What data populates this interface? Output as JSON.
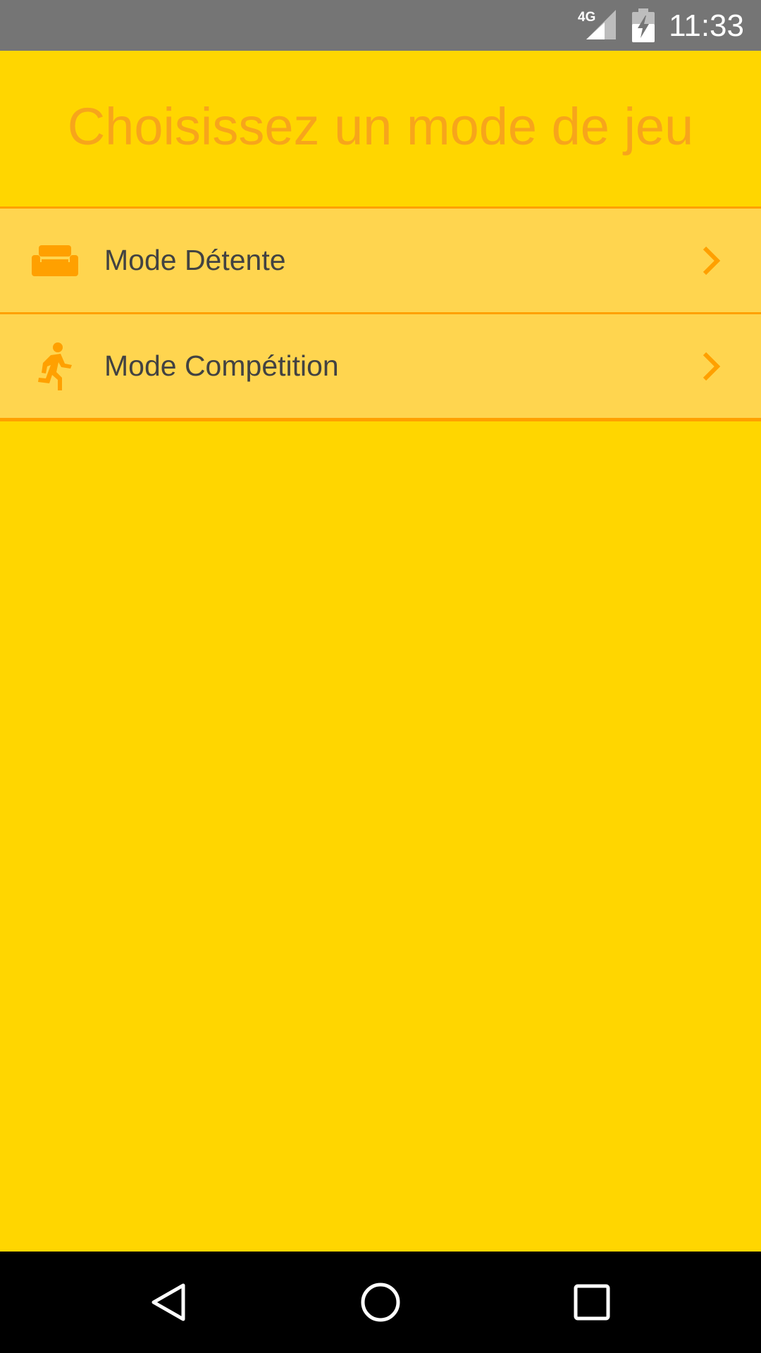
{
  "status_bar": {
    "network": "4G",
    "time": "11:33",
    "signal_icon": "cell-signal-icon",
    "battery_icon": "battery-charging-icon"
  },
  "header": {
    "title": "Choisissez un mode de jeu"
  },
  "menu": {
    "items": [
      {
        "label": "Mode Détente",
        "icon": "sofa-icon"
      },
      {
        "label": "Mode Compétition",
        "icon": "running-person-icon"
      }
    ]
  },
  "nav_bar": {
    "back_icon": "back-triangle-icon",
    "home_icon": "home-circle-icon",
    "recents_icon": "recents-square-icon"
  },
  "colors": {
    "background": "#FFD600",
    "header_title": "#F7A51B",
    "item_background": "#FFD54F",
    "accent": "#FFA000",
    "item_text": "#424242",
    "status_bar": "#757575",
    "nav_bar": "#000000"
  }
}
